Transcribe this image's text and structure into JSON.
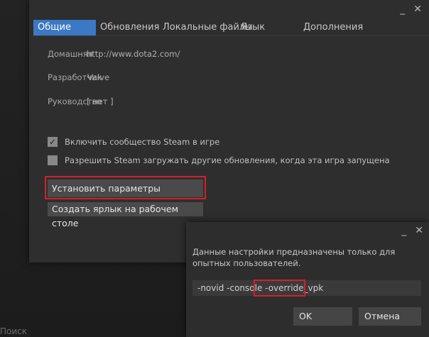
{
  "background": {
    "search_text": "Поиск"
  },
  "properties_window": {
    "minimize": "_",
    "close": "✕",
    "tabs": [
      "Общие",
      "Обновления",
      "Локальные файлы",
      "Язык",
      "Дополнения"
    ],
    "homepage_label": "Домашняя",
    "homepage_value": "http://www.dota2.com/",
    "developer_label": "Разработчик",
    "developer_value": "Valve",
    "manual_label": "Руководство",
    "manual_value": "[ нет ]",
    "overlay_checkbox": {
      "label": "Включить сообщество Steam в игре",
      "checked": true,
      "check": "✓"
    },
    "background_updates_checkbox": {
      "label": "Разрешить Steam загружать другие обновления, когда эта игра запущена",
      "checked": false
    },
    "launch_options_button": "Установить параметры запуска...",
    "shortcut_button": "Создать ярлык на рабочем столе"
  },
  "launch_options_dialog": {
    "minimize": "_",
    "close": "✕",
    "message": "Данные настройки предназначены только для опытных пользователей.",
    "input_prefix": "-novid -console ",
    "input_highlight": "-override_vpk",
    "ok_button": "OK",
    "cancel_button": "Отмена"
  },
  "colors": {
    "accent": "#3b79c4",
    "highlight": "#d4202a"
  }
}
